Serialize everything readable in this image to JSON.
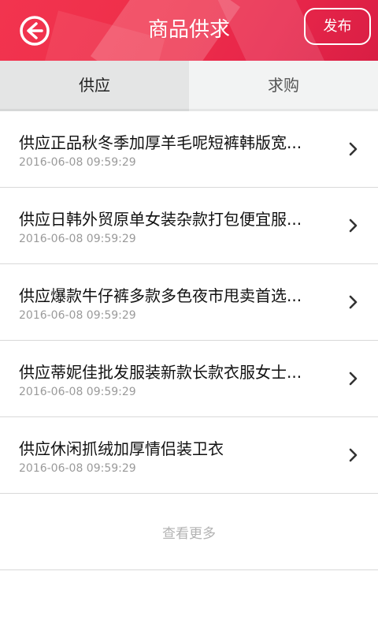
{
  "header": {
    "title": "商品供求",
    "publish_label": "发布",
    "back_icon": "back-arrow-circle-icon",
    "background_color": "#ee2e49"
  },
  "tabs": [
    {
      "label": "供应",
      "active": true
    },
    {
      "label": "求购",
      "active": false
    }
  ],
  "items": [
    {
      "title": "供应正品秋冬季加厚羊毛呢短裤韩版宽...",
      "date": "2016-06-08 09:59:29"
    },
    {
      "title": "供应日韩外贸原单女装杂款打包便宜服...",
      "date": "2016-06-08 09:59:29"
    },
    {
      "title": "供应爆款牛仔裤多款多色夜市甩卖首选...",
      "date": "2016-06-08 09:59:29"
    },
    {
      "title": "供应蒂妮佳批发服装新款长款衣服女士...",
      "date": "2016-06-08 09:59:29"
    },
    {
      "title": "供应休闲抓绒加厚情侣装卫衣",
      "date": "2016-06-08 09:59:29"
    }
  ],
  "more_label": "查看更多",
  "chevron_icon": "chevron-right-icon"
}
